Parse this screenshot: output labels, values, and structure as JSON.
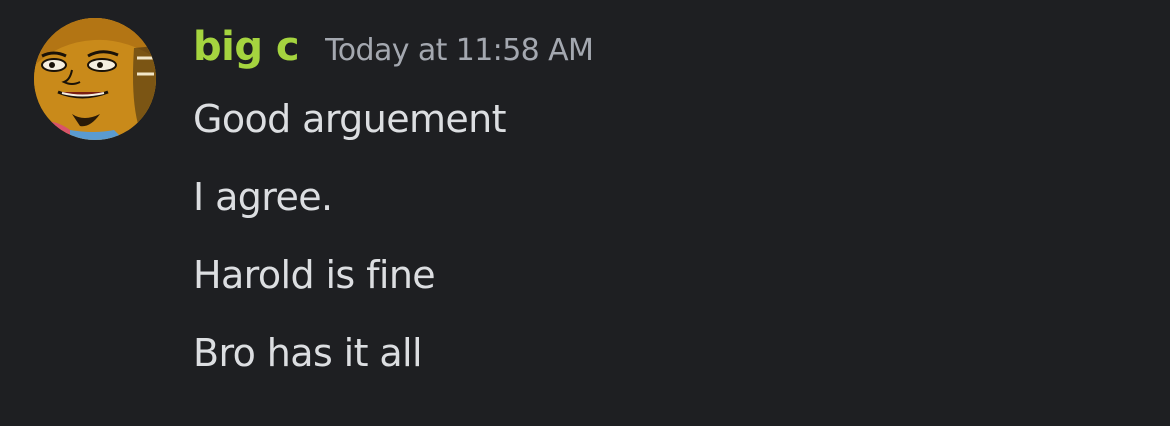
{
  "message": {
    "author": {
      "name": "big c",
      "name_color": "#a5d43f",
      "avatar": "cartoon-face-avatar"
    },
    "timestamp": "Today at 11:58 AM",
    "lines": [
      "Good arguement",
      "I agree.",
      "Harold is fine",
      "Bro has it all"
    ]
  },
  "theme": {
    "background": "#1e1f22",
    "text": "#dcdee1",
    "muted": "#a4a8b0"
  }
}
